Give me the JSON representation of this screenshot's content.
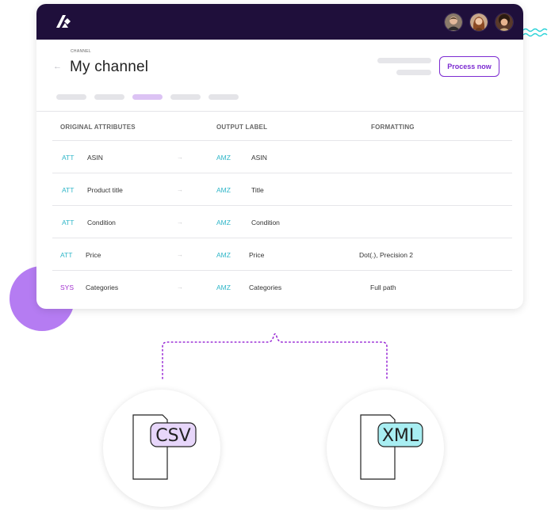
{
  "header": {
    "caption": "CHANNEL",
    "back_icon": "←",
    "title": "My channel",
    "process_button": "Process now"
  },
  "topbar": {
    "avatars": [
      "avatar-1",
      "avatar-2",
      "avatar-3"
    ]
  },
  "table": {
    "columns": [
      "ORIGINAL ATTRIBUTES",
      "OUTPUT LABEL",
      "FORMATTING"
    ],
    "rows": [
      {
        "source_tag": "ATT",
        "source": "ASIN",
        "arrow": "→",
        "target_tag": "AMZ",
        "target": "ASIN",
        "formatting": ""
      },
      {
        "source_tag": "ATT",
        "source": "Product title",
        "arrow": "→",
        "target_tag": "AMZ",
        "target": "Title",
        "formatting": ""
      },
      {
        "source_tag": "ATT",
        "source": "Condition",
        "arrow": "→",
        "target_tag": "AMZ",
        "target": "Condition",
        "formatting": ""
      },
      {
        "source_tag": "ATT",
        "source": "Price",
        "arrow": "→",
        "target_tag": "AMZ",
        "target": "Price",
        "formatting": "Dot(.), Precision 2"
      },
      {
        "source_tag": "SYS",
        "source": "Categories",
        "arrow": "→",
        "target_tag": "AMZ",
        "target": "Categories",
        "formatting": "Full path"
      }
    ]
  },
  "outputs": {
    "csv_label": "CSV",
    "xml_label": "XML"
  },
  "colors": {
    "topbar": "#1f0f3b",
    "accent": "#7c2bd1",
    "att_tag": "#2fb6c8",
    "sys_tag": "#a231cf",
    "blob": "#b57cf2"
  }
}
